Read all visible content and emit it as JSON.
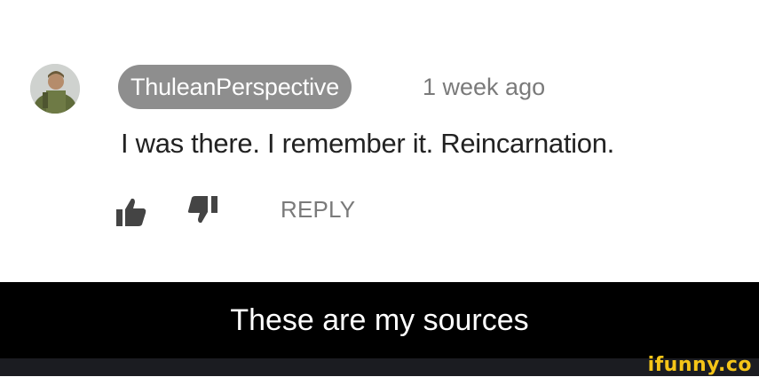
{
  "comment": {
    "author": "ThuleanPerspective",
    "timestamp": "1 week ago",
    "text": "I was there. I remember it. Reincarnation.",
    "actions": {
      "like_icon": "thumbs-up-icon",
      "dislike_icon": "thumbs-down-icon",
      "reply_label": "REPLY"
    }
  },
  "caption": {
    "text": "These are my sources"
  },
  "watermark": {
    "text": "ifunny.co"
  },
  "colors": {
    "author_pill_bg": "#8e8e8e",
    "caption_bg": "#000000",
    "footer_bg": "#1b1c21",
    "watermark": "#f5c518"
  }
}
